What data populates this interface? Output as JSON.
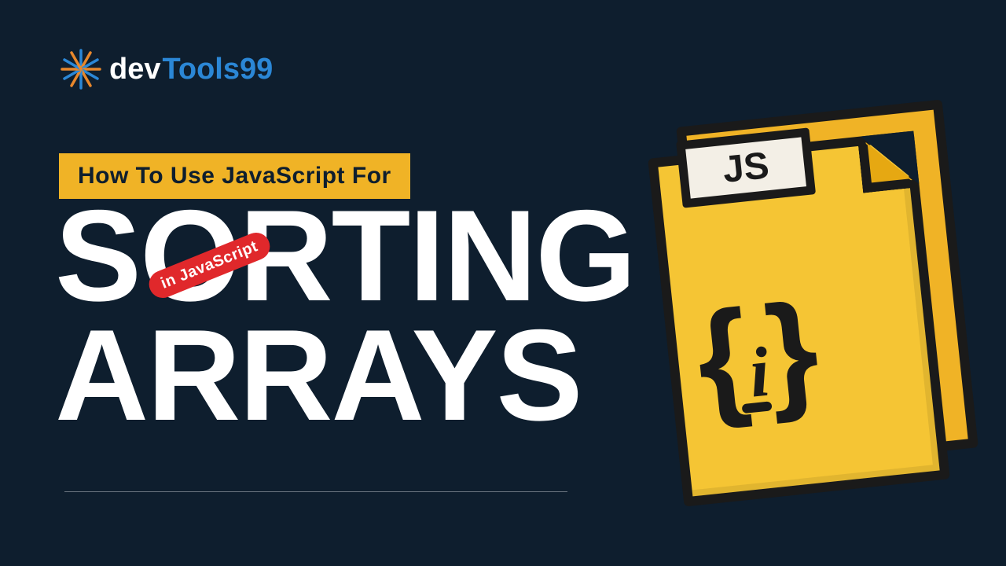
{
  "logo": {
    "dev": "dev",
    "tools": "Tools",
    "ninetynine": "99"
  },
  "badge": "How To Use JavaScript For",
  "heading": {
    "line1": "SORTING",
    "line2": "ARRAYS"
  },
  "sticker": "in  JavaScript",
  "jsfile": {
    "label": "JS",
    "brace_left": "{",
    "brace_right": "}",
    "icon_letter": "i"
  }
}
